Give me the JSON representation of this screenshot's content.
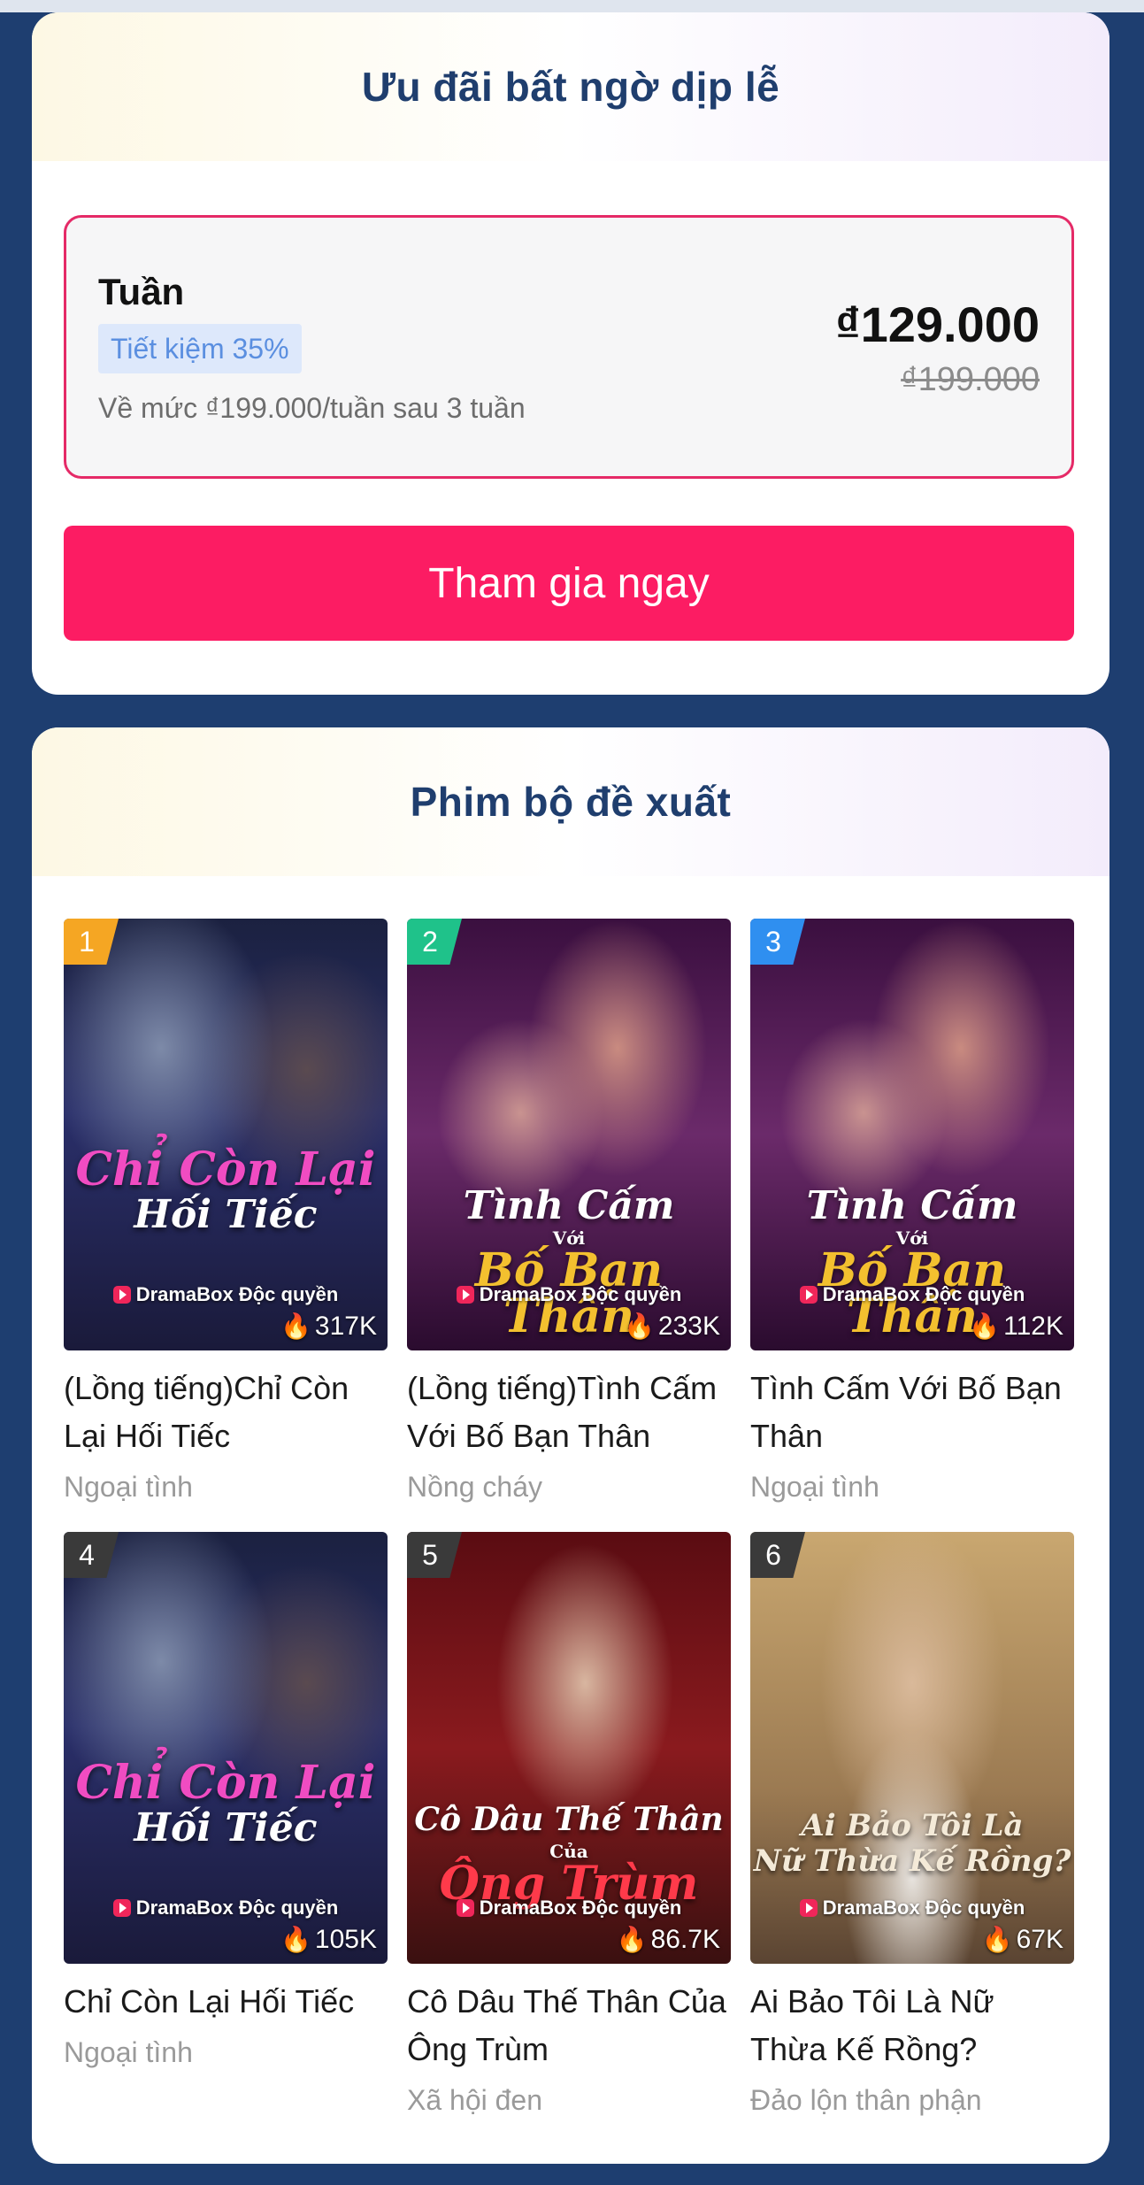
{
  "offer": {
    "title": "Ưu đãi bất ngờ dịp lễ",
    "plan": {
      "name": "Tuần",
      "badge": "Tiết kiệm 35%",
      "renew_note": "Về mức ₫199.000/tuần sau 3 tuần",
      "price": "₫129.000",
      "old_price": "₫199.000"
    },
    "cta_label": "Tham gia ngay"
  },
  "recommend": {
    "title": "Phim bộ đề xuất",
    "brand_label": "DramaBox Độc quyền",
    "items": [
      {
        "rank": "1",
        "rank_color": "#f5a623",
        "poster_line1": "Chỉ Còn Lại",
        "poster_line2": "Hối Tiếc",
        "poster_small": "",
        "views": "317K",
        "name": "(Lồng tiếng)Chỉ Còn Lại Hối Tiếc",
        "genre": "Ngoại tình"
      },
      {
        "rank": "2",
        "rank_color": "#1fc28a",
        "poster_line1": "Tình Cấm",
        "poster_small": "Với",
        "poster_line2": "Bố Bạn Thân",
        "views": "233K",
        "name": "(Lồng tiếng)Tình Cấm Với Bố Bạn Thân",
        "genre": "Nồng cháy"
      },
      {
        "rank": "3",
        "rank_color": "#2f8ff0",
        "poster_line1": "Tình Cấm",
        "poster_small": "Với",
        "poster_line2": "Bố Bạn Thân",
        "views": "112K",
        "name": "Tình Cấm Với Bố Bạn Thân",
        "genre": "Ngoại tình"
      },
      {
        "rank": "4",
        "rank_color": "#3a3a3a",
        "poster_line1": "Chỉ Còn Lại",
        "poster_line2": "Hối Tiếc",
        "poster_small": "",
        "views": "105K",
        "name": "Chỉ Còn Lại Hối Tiếc",
        "genre": "Ngoại tình"
      },
      {
        "rank": "5",
        "rank_color": "#3a3a3a",
        "poster_line1": "Cô Dâu Thế Thân",
        "poster_small": "Của",
        "poster_line2": "Ông Trùm",
        "views": "86.7K",
        "name": "Cô Dâu Thế Thân Của Ông Trùm",
        "genre": "Xã hội đen"
      },
      {
        "rank": "6",
        "rank_color": "#3a3a3a",
        "poster_line1": "Ai Bảo Tôi Là",
        "poster_line2": "Nữ Thừa Kế Rồng?",
        "poster_small": "",
        "views": "67K",
        "name": "Ai Bảo Tôi Là Nữ Thừa Kế Rồng?",
        "genre": "Đảo lộn thân phận"
      }
    ]
  }
}
